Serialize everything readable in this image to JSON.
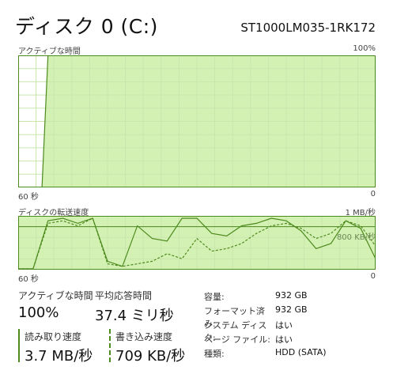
{
  "header": {
    "title": "ディスク 0 (C:)",
    "model": "ST1000LM035-1RK172"
  },
  "active_chart": {
    "label": "アクティブな時間",
    "max_label": "100%",
    "x_left_label": "60 秒",
    "x_right_label": "0"
  },
  "transfer_chart": {
    "label": "ディスクの転送速度",
    "max_label": "1 MB/秒",
    "mid_label": "800 KB/秒",
    "x_left_label": "60 秒",
    "x_right_label": "0"
  },
  "stats": {
    "active_time_label": "アクティブな時間",
    "active_time_value": "100%",
    "avg_response_label": "平均応答時間",
    "avg_response_value": "37.4 ミリ秒",
    "read_speed_label": "読み取り速度",
    "read_speed_value": "3.7 MB/秒",
    "write_speed_label": "書き込み速度",
    "write_speed_value": "709 KB/秒"
  },
  "properties": [
    {
      "label": "容量:",
      "value": "932 GB"
    },
    {
      "label": "フォーマット済み:",
      "value": "932 GB"
    },
    {
      "label": "システム ディスク:",
      "value": "はい"
    },
    {
      "label": "ページ ファイル:",
      "value": "はい"
    },
    {
      "label": "種類:",
      "value": "HDD (SATA)"
    }
  ],
  "colors": {
    "fill": "#d4f1b4",
    "line": "#4d8a1e",
    "grid": "#c9e6ad",
    "border": "#4d8a1e"
  },
  "chart_data": [
    {
      "type": "area",
      "title": "アクティブな時間",
      "x": [
        60,
        57,
        56,
        55,
        0
      ],
      "values": [
        0,
        0,
        0,
        100,
        100
      ],
      "xlabel": "",
      "ylabel": "",
      "ylim": [
        0,
        100
      ]
    },
    {
      "type": "line",
      "title": "ディスクの転送速度",
      "series": [
        {
          "values": [
            0,
            0,
            0.95,
            1.0,
            0.9,
            1.0,
            0.15,
            0.05,
            0.85,
            0.6,
            0.55,
            1.0,
            1.0,
            0.7,
            0.65,
            0.85,
            0.9,
            1.0,
            0.95,
            0.75,
            0.4,
            0.5,
            0.95,
            0.8,
            0.2
          ]
        },
        {
          "values": [
            0,
            0,
            0.9,
            0.95,
            0.85,
            1.0,
            0.1,
            0.05,
            0.1,
            0.15,
            0.3,
            0.2,
            0.6,
            0.35,
            0.4,
            0.5,
            0.7,
            0.85,
            0.9,
            0.8,
            0.6,
            0.7,
            0.95,
            0.85,
            0.45
          ]
        }
      ],
      "ylim": [
        0,
        1
      ]
    }
  ]
}
